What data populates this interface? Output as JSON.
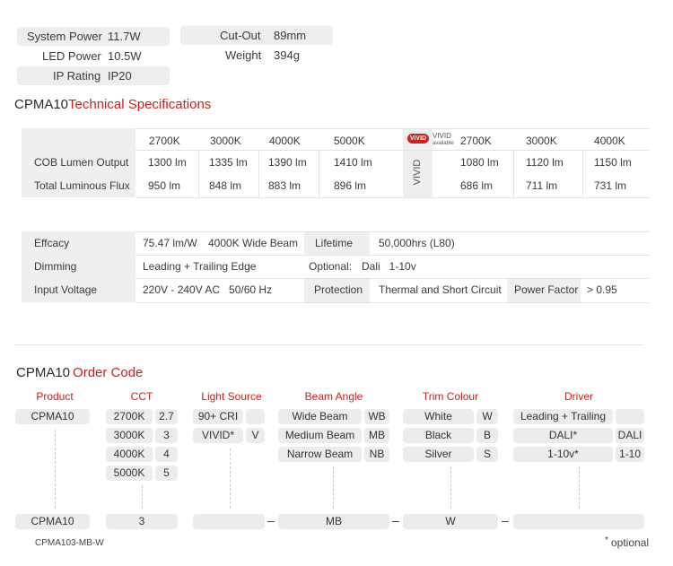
{
  "summary": {
    "system_power_label": "System Power",
    "system_power_value": "11.7W",
    "led_power_label": "LED Power",
    "led_power_value": "10.5W",
    "ip_rating_label": "IP Rating",
    "ip_rating_value": "IP20",
    "cutout_label": "Cut-Out",
    "cutout_value": "89mm",
    "weight_label": "Weight",
    "weight_value": "394g"
  },
  "tech_heading": {
    "model": "CPMA10",
    "title": "Technical Specifications"
  },
  "lumen_table": {
    "standard_temps": [
      "2700K",
      "3000K",
      "4000K",
      "5000K"
    ],
    "vivid_badge": "ViVID",
    "vivid_brand": "VIVID",
    "vivid_available": "available",
    "vivid_vertical": "VIVID",
    "vivid_temps": [
      "2700K",
      "3000K",
      "4000K"
    ],
    "row1_label": "COB Lumen Output",
    "row1_standard": [
      "1300 lm",
      "1335 lm",
      "1390 lm",
      "1410 lm"
    ],
    "row1_vivid": [
      "1080 lm",
      "1120 lm",
      "1150 lm"
    ],
    "row2_label": "Total Luminous Flux",
    "row2_standard": [
      "950 lm",
      "848 lm",
      "883 lm",
      "896 lm"
    ],
    "row2_vivid": [
      "686 lm",
      "711 lm",
      "731 lm"
    ]
  },
  "props_table": {
    "efficacy_label": "Effcacy",
    "efficacy_value": "75.47 lm/W",
    "efficacy_beam": "4000K Wide Beam",
    "lifetime_label": "Lifetime",
    "lifetime_value": "50,000hrs (L80)",
    "dimming_label": "Dimming",
    "dimming_value": "Leading + Trailing Edge",
    "dimming_optional": "Optional:",
    "dimming_options": "Dali   1-10v",
    "input_label": "Input Voltage",
    "input_value": "220V - 240V AC   50/60 Hz",
    "protection_label": "Protection",
    "protection_value": "Thermal and Short Circuit",
    "power_factor_label": "Power Factor",
    "power_factor_value": "> 0.95"
  },
  "order_heading": {
    "model": "CPMA10",
    "title": "Order Code"
  },
  "order": {
    "headers": {
      "product": "Product",
      "cct": "CCT",
      "light_source": "Light Source",
      "beam_angle": "Beam Angle",
      "trim_colour": "Trim Colour",
      "driver": "Driver"
    },
    "product": "CPMA10",
    "cct": [
      {
        "label": "2700K",
        "code": "2.7"
      },
      {
        "label": "3000K",
        "code": "3"
      },
      {
        "label": "4000K",
        "code": "4"
      },
      {
        "label": "5000K",
        "code": "5"
      }
    ],
    "light_source": [
      {
        "label": "90+ CRI",
        "code": ""
      },
      {
        "label": "VIVID*",
        "code": "V"
      }
    ],
    "beam_angle": [
      {
        "label": "Wide Beam",
        "code": "WB"
      },
      {
        "label": "Medium Beam",
        "code": "MB"
      },
      {
        "label": "Narrow Beam",
        "code": "NB"
      }
    ],
    "trim_colour": [
      {
        "label": "White",
        "code": "W"
      },
      {
        "label": "Black",
        "code": "B"
      },
      {
        "label": "Silver",
        "code": "S"
      }
    ],
    "driver": [
      {
        "label": "Leading + Trailing",
        "code": ""
      },
      {
        "label": "DALI*",
        "code": "DALI"
      },
      {
        "label": "1-10v*",
        "code": "1-10"
      }
    ],
    "example": {
      "product": "CPMA10",
      "cct": "3",
      "light_source": "",
      "beam": "MB",
      "trim": "W",
      "driver": "",
      "sep": "–"
    },
    "example_code": "CPMA103-MB-W",
    "optional_star": "*",
    "optional_note": "optional"
  }
}
